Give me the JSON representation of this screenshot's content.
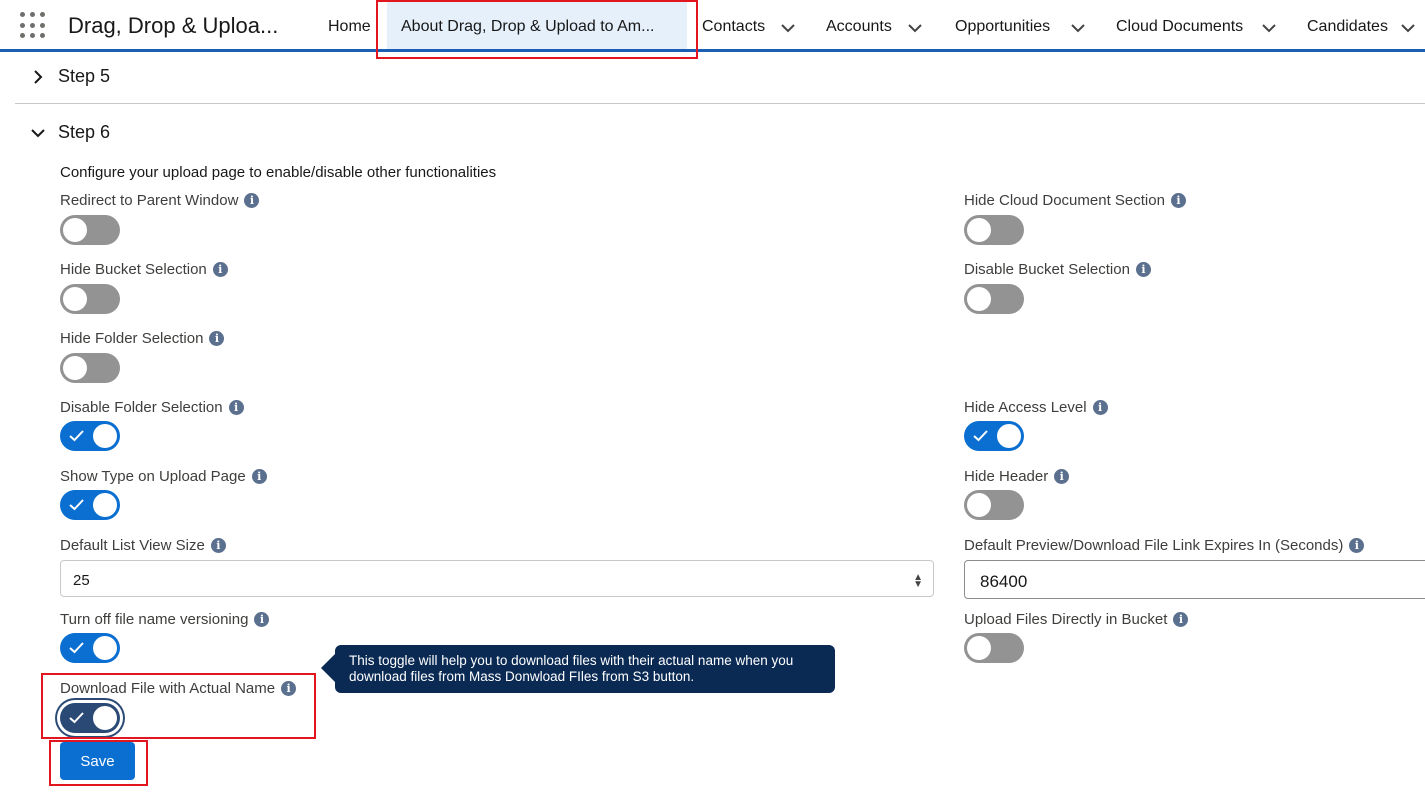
{
  "nav": {
    "app_name": "Drag, Drop & Uploa...",
    "items": [
      {
        "label": "Home"
      },
      {
        "label": "About Drag, Drop & Upload to Am..."
      },
      {
        "label": "Contacts"
      },
      {
        "label": "Accounts"
      },
      {
        "label": "Opportunities"
      },
      {
        "label": "Cloud Documents"
      },
      {
        "label": "Candidates"
      }
    ],
    "accent_color": "#1b5fb5"
  },
  "sections": {
    "step5": {
      "label": "Step 5",
      "expanded": false
    },
    "step6": {
      "label": "Step 6",
      "expanded": true
    }
  },
  "step6": {
    "description": "Configure your upload page to enable/disable other functionalities",
    "fields": {
      "redirect_parent": {
        "label": "Redirect to Parent Window",
        "on": false
      },
      "hide_bucket_selection": {
        "label": "Hide Bucket Selection",
        "on": false
      },
      "hide_folder_selection": {
        "label": "Hide Folder Selection",
        "on": false
      },
      "disable_folder_selection": {
        "label": "Disable Folder Selection",
        "on": true
      },
      "show_type": {
        "label": "Show Type on Upload Page",
        "on": true
      },
      "default_list_view_size": {
        "label": "Default List View Size",
        "value": "25"
      },
      "turn_off_versioning": {
        "label": "Turn off file name versioning",
        "on": true
      },
      "download_actual_name": {
        "label": "Download File with Actual Name",
        "on": true
      },
      "hide_cloud_doc": {
        "label": "Hide Cloud Document Section",
        "on": false
      },
      "disable_bucket_selection": {
        "label": "Disable Bucket Selection",
        "on": false
      },
      "hide_access_level": {
        "label": "Hide Access Level",
        "on": true
      },
      "hide_header": {
        "label": "Hide Header",
        "on": false
      },
      "link_expires": {
        "label": "Default Preview/Download File Link Expires In (Seconds)",
        "value": "86400"
      },
      "upload_directly": {
        "label": "Upload Files Directly in Bucket",
        "on": false
      }
    },
    "tooltip": "This toggle will help you to download files with their actual name when you download files from Mass Donwload FIles from S3 button.",
    "save_label": "Save"
  },
  "colors": {
    "toggle_on": "#0b6fd1",
    "toggle_off": "#939393",
    "highlight": "#e2161e",
    "tooltip_bg": "#0a2a54"
  }
}
